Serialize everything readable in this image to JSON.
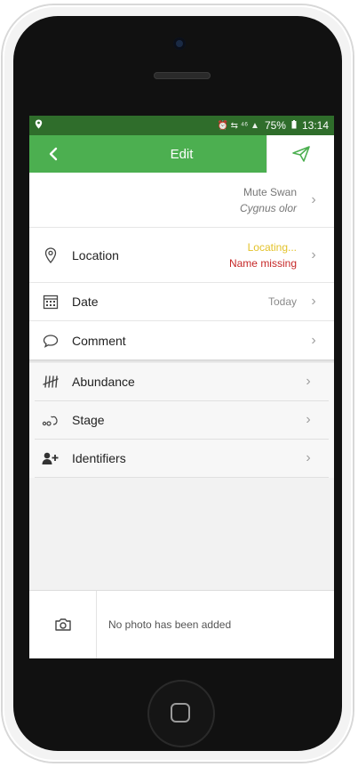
{
  "status_bar": {
    "left_icon": "location-pin-icon",
    "battery_percent": "75%",
    "time": "13:14",
    "icons_text": "⏰ ⇆ ⁴⁶ ▲"
  },
  "header": {
    "back_icon": "chevron-left-icon",
    "title": "Edit",
    "send_icon": "paper-plane-icon"
  },
  "species": {
    "common_name": "Mute Swan",
    "scientific_name": "Cygnus olor"
  },
  "rows": {
    "location": {
      "label": "Location",
      "status": "Locating...",
      "warning": "Name missing"
    },
    "date": {
      "label": "Date",
      "value": "Today"
    },
    "comment": {
      "label": "Comment"
    },
    "abundance": {
      "label": "Abundance"
    },
    "stage": {
      "label": "Stage"
    },
    "identifiers": {
      "label": "Identifiers"
    }
  },
  "chevron": "›",
  "photo": {
    "message": "No photo has been added",
    "camera_icon": "camera-icon"
  },
  "colors": {
    "header_green": "#4caf50",
    "status_green": "#2f6d2b",
    "locating_yellow": "#e3c22a",
    "missing_red": "#c62828"
  }
}
